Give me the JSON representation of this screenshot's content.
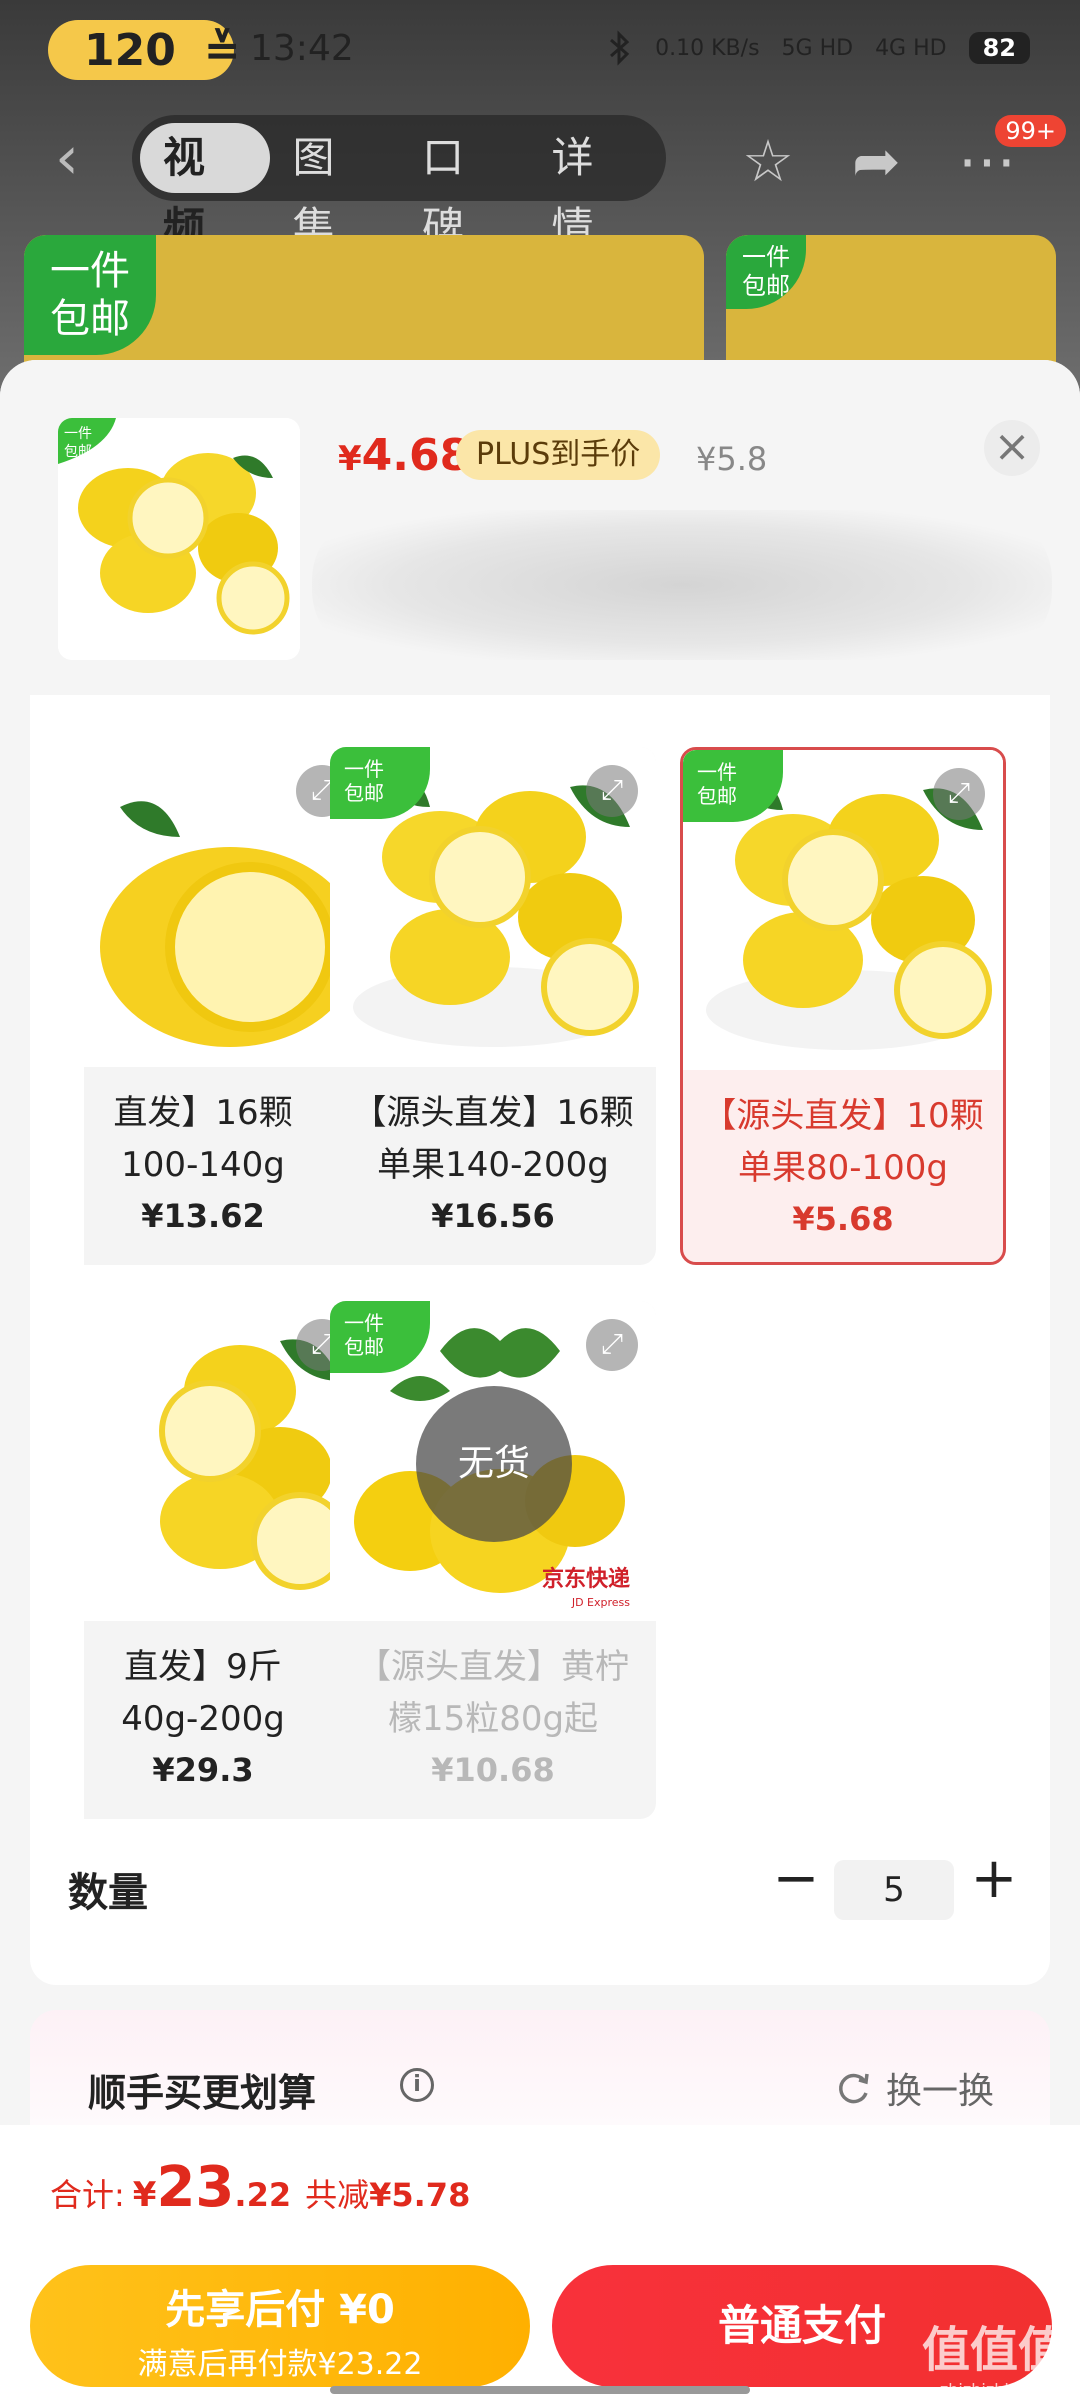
{
  "status_bar": {
    "speed_pill": "120",
    "speed_icon": "≚",
    "time": "13:42",
    "net_speed": "0.10 KB/s",
    "signal_1": "5G HD",
    "signal_2": "4G HD",
    "battery": "82",
    "icons": [
      "bluetooth-icon",
      "signal-icon"
    ]
  },
  "nav": {
    "tabs": [
      {
        "label": "视频",
        "active": true
      },
      {
        "label": "图集",
        "active": false
      },
      {
        "label": "口碑",
        "active": false
      },
      {
        "label": "详情",
        "active": false
      }
    ],
    "badge": "99+"
  },
  "background_banner": {
    "tag_line1": "一件",
    "tag_line2": "包邮"
  },
  "sheet": {
    "price_symbol": "¥",
    "price_now": "4.68",
    "plus_tag": "PLUS到手价",
    "price_old": "¥5.8",
    "close": "×"
  },
  "options": [
    {
      "name_line1": "直发】16颗",
      "name_line2": "100-140g",
      "price": "¥13.62",
      "state": "normal",
      "tag_line1": "",
      "tag_line2": ""
    },
    {
      "name_line1": "【源头直发】16颗",
      "name_line2": "单果140-200g",
      "price": "¥16.56",
      "state": "normal",
      "tag_line1": "一件",
      "tag_line2": "包邮"
    },
    {
      "name_line1": "【源头直发】10颗",
      "name_line2": "单果80-100g",
      "price": "¥5.68",
      "state": "selected",
      "tag_line1": "一件",
      "tag_line2": "包邮"
    },
    {
      "name_line1": "直发】9斤",
      "name_line2": "40g-200g",
      "price": "¥29.3",
      "state": "normal",
      "tag_line1": "",
      "tag_line2": ""
    },
    {
      "name_line1": "【源头直发】黄柠",
      "name_line2": "檬15粒80g起",
      "price": "¥10.68",
      "state": "disabled",
      "tag_line1": "一件",
      "tag_line2": "包邮",
      "overlay": "无货",
      "brand_line1": "京东快递",
      "brand_line2": "JD Express"
    }
  ],
  "quantity": {
    "label": "数量",
    "minus": "−",
    "value": "5",
    "plus": "+"
  },
  "addon": {
    "title": "顺手买更划算",
    "info": "i",
    "refresh_label": "换一换"
  },
  "footer": {
    "total_label": "合计:",
    "currency": "¥",
    "total_int": "23",
    "total_dec": ".22",
    "discount_label": "共减",
    "discount_value": "¥5.78",
    "later_line1": "先享后付 ¥0",
    "later_line2": "满意后再付款¥23.22",
    "pay_label": "普通支付"
  },
  "watermark": {
    "line1": "值值值",
    "line2": "zhizhizhi.com"
  },
  "colors": {
    "accent_red": "#e02a1d",
    "pay_red": "#f23030",
    "later_yellow": "#ffb000",
    "free_ship_green": "#3bbf3b",
    "selected_border": "#d84c4c"
  }
}
